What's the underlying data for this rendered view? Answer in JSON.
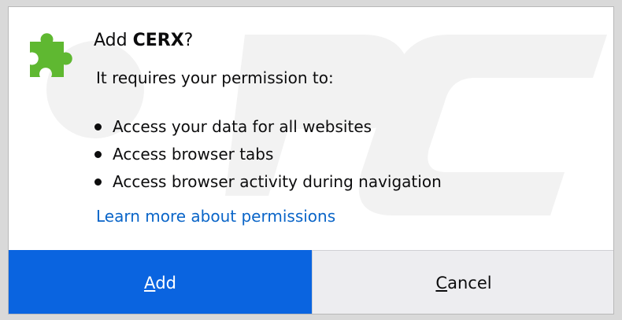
{
  "dialog": {
    "title_prefix": "Add ",
    "extension_name": "CERX",
    "title_suffix": "?",
    "subtitle": "It requires your permission to:",
    "permissions": [
      "Access your data for all websites",
      "Access browser tabs",
      "Access browser activity during navigation"
    ],
    "learn_more_label": "Learn more about permissions",
    "add_button": {
      "accesskey": "A",
      "rest": "dd"
    },
    "cancel_button": {
      "accesskey": "C",
      "rest": "ancel"
    }
  },
  "icons": {
    "extension": "puzzle-piece-icon"
  },
  "colors": {
    "primary_button": "#0a64e0",
    "secondary_button": "#ededf0",
    "link": "#0a65c8",
    "puzzle_green": "#5fb831"
  }
}
